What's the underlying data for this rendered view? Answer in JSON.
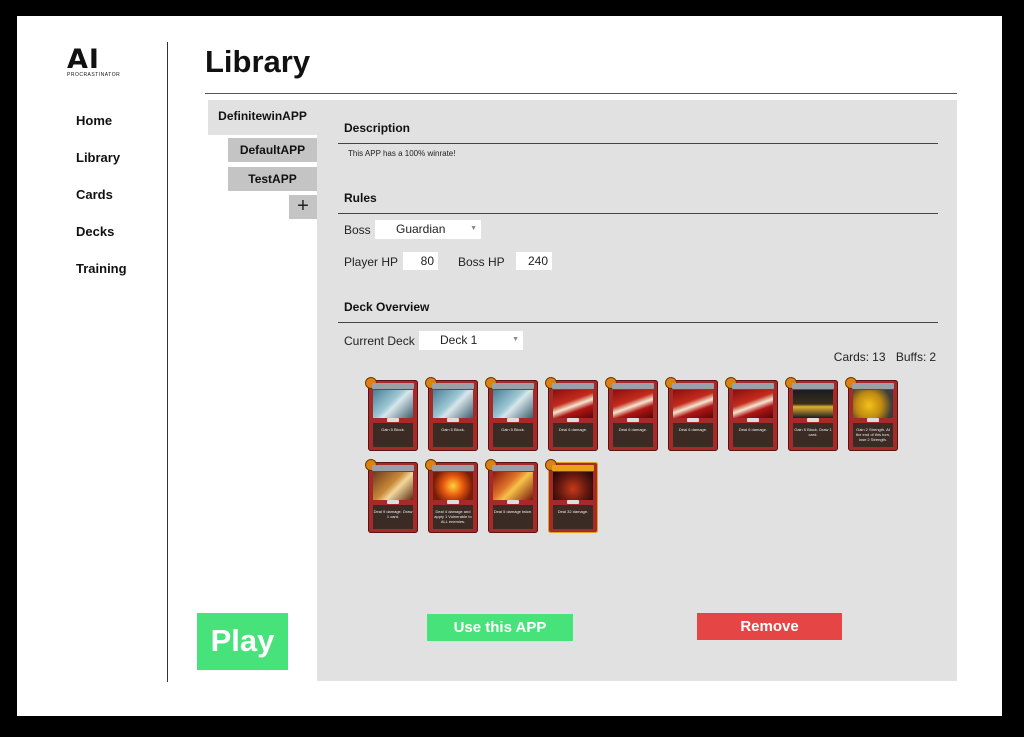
{
  "logo": {
    "text": "AI",
    "subtext": "PROCRASTINATOR"
  },
  "nav": [
    "Home",
    "Library",
    "Cards",
    "Decks",
    "Training"
  ],
  "page_title": "Library",
  "apps": {
    "active": "DefinitewinAPP",
    "others": [
      "DefaultAPP",
      "TestAPP"
    ],
    "add_symbol": "+"
  },
  "description": {
    "heading": "Description",
    "text": "This APP has a 100% winrate!"
  },
  "rules": {
    "heading": "Rules",
    "boss_label": "Boss",
    "boss_value": "Guardian",
    "player_hp_label": "Player HP",
    "player_hp": "80",
    "boss_hp_label": "Boss HP",
    "boss_hp": "240"
  },
  "deck": {
    "heading": "Deck Overview",
    "current_label": "Current Deck",
    "current_value": "Deck 1",
    "cards_label": "Cards:",
    "cards_count": "13",
    "buffs_label": "Buffs:",
    "buffs_count": "2"
  },
  "cards": [
    {
      "art": "shield",
      "text": "Gain 5 Block."
    },
    {
      "art": "shield",
      "text": "Gain 5 Block."
    },
    {
      "art": "shield",
      "text": "Gain 5 Block."
    },
    {
      "art": "slash",
      "text": "Deal 6 damage."
    },
    {
      "art": "slash",
      "text": "Deal 6 damage."
    },
    {
      "art": "slash",
      "text": "Deal 6 damage."
    },
    {
      "art": "slash",
      "text": "Deal 6 damage."
    },
    {
      "art": "dark",
      "text": "Gain 5 Block. Draw 1 card."
    },
    {
      "art": "gold",
      "text": "Gain 2 Strength. At the end of this turn, lose 2 Strength."
    },
    {
      "art": "bash",
      "text": "Deal 9 damage. Draw 1 card."
    },
    {
      "art": "fire",
      "text": "Deal 4 damage and apply 1 Vulnerable to ALL enemies."
    },
    {
      "art": "twin",
      "text": "Deal 5 damage twice."
    },
    {
      "art": "bludgeon",
      "text": "Deal 32 damage."
    }
  ],
  "buttons": {
    "play": "Play",
    "use": "Use this APP",
    "remove": "Remove"
  },
  "colors": {
    "green": "#47e27a",
    "red": "#e64545",
    "panel": "#e1e1e1",
    "tab": "#c4c4c4"
  }
}
